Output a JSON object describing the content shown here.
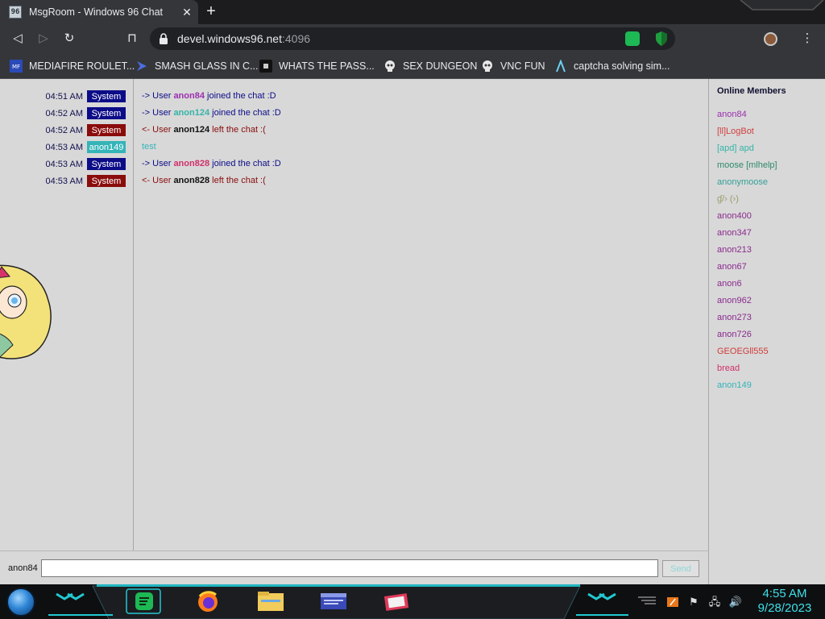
{
  "browser": {
    "tab_title": "MsgRoom - Windows 96 Chat",
    "tab_close": "✕",
    "new_tab": "+",
    "url_host": "devel.windows96.net",
    "url_port": ":4096",
    "back_icon": "◁",
    "forward_icon": "▷",
    "reload_icon": "↻",
    "bookmark_icon": "⊓",
    "menu_icon": "⋮",
    "bookmarks": [
      {
        "label": "MEDIAFIRE ROULET...",
        "icon": "mediafire-icon"
      },
      {
        "label": "SMASH GLASS IN C...",
        "icon": "chevron-logo-icon"
      },
      {
        "label": "WHATS THE PASS...",
        "icon": "dark-site-icon"
      },
      {
        "label": "SEX DUNGEON",
        "icon": "skull-icon"
      },
      {
        "label": "VNC FUN",
        "icon": "skull-icon"
      },
      {
        "label": "captcha solving sim...",
        "icon": "lambda-icon"
      }
    ]
  },
  "chat": {
    "rows": [
      {
        "time": "04:51 AM",
        "user": "System",
        "badge_color": "#0c0c88",
        "prefix": "-> User ",
        "name": "anon84",
        "name_color": "#9b2fae",
        "suffix": " joined the chat :D",
        "text_color": "#0c0c88",
        "plain": ""
      },
      {
        "time": "04:52 AM",
        "user": "System",
        "badge_color": "#0c0c88",
        "prefix": "-> User ",
        "name": "anon124",
        "name_color": "#35b4a8",
        "suffix": " joined the chat :D",
        "text_color": "#0c0c88",
        "plain": ""
      },
      {
        "time": "04:52 AM",
        "user": "System",
        "badge_color": "#8a0c0c",
        "prefix": "<- User ",
        "name": "anon124",
        "name_color": "#101010",
        "suffix": " left the chat :(",
        "text_color": "#8a0c0c",
        "plain": ""
      },
      {
        "time": "04:53 AM",
        "user": "anon149",
        "badge_color": "#35b4b8",
        "prefix": "",
        "name": "",
        "name_color": "#101010",
        "suffix": "",
        "text_color": "#35b4b8",
        "plain": "test"
      },
      {
        "time": "04:53 AM",
        "user": "System",
        "badge_color": "#0c0c88",
        "prefix": "-> User ",
        "name": "anon828",
        "name_color": "#d0306a",
        "suffix": " joined the chat :D",
        "text_color": "#0c0c88",
        "plain": ""
      },
      {
        "time": "04:53 AM",
        "user": "System",
        "badge_color": "#8a0c0c",
        "prefix": "<- User ",
        "name": "anon828",
        "name_color": "#101010",
        "suffix": " left the chat :(",
        "text_color": "#8a0c0c",
        "plain": ""
      }
    ],
    "members_header": "Online Members",
    "members": [
      {
        "name": "anon84",
        "color": "#9b2fae"
      },
      {
        "name": "[ll]LogBot",
        "color": "#d04040"
      },
      {
        "name": "[apd] apd",
        "color": "#35b4a8"
      },
      {
        "name": "moose [mlhelp]",
        "color": "#2e8a6a"
      },
      {
        "name": "anonymoose",
        "color": "#35a098"
      },
      {
        "name": "ɠ/› (›)",
        "color": "#9a9a6a"
      },
      {
        "name": "anon400",
        "color": "#8a2a8e"
      },
      {
        "name": "anon347",
        "color": "#8a2a8e"
      },
      {
        "name": "anon213",
        "color": "#8a2a8e"
      },
      {
        "name": "anon67",
        "color": "#8a2a8e"
      },
      {
        "name": "anon6",
        "color": "#8a2a8e"
      },
      {
        "name": "anon962",
        "color": "#8a2a8e"
      },
      {
        "name": "anon273",
        "color": "#8a2a8e"
      },
      {
        "name": "anon726",
        "color": "#8a2a8e"
      },
      {
        "name": "GEOEGll555",
        "color": "#d03a3a"
      },
      {
        "name": "bread",
        "color": "#d0306a"
      },
      {
        "name": "anon149",
        "color": "#35b4b8"
      }
    ],
    "composer": {
      "username": "anon84",
      "value": "",
      "send_label": "Send"
    }
  },
  "taskbar": {
    "time": "4:55 AM",
    "date": "9/28/2023",
    "tray_icons": [
      "⚑",
      "🖧",
      "🔊"
    ]
  }
}
